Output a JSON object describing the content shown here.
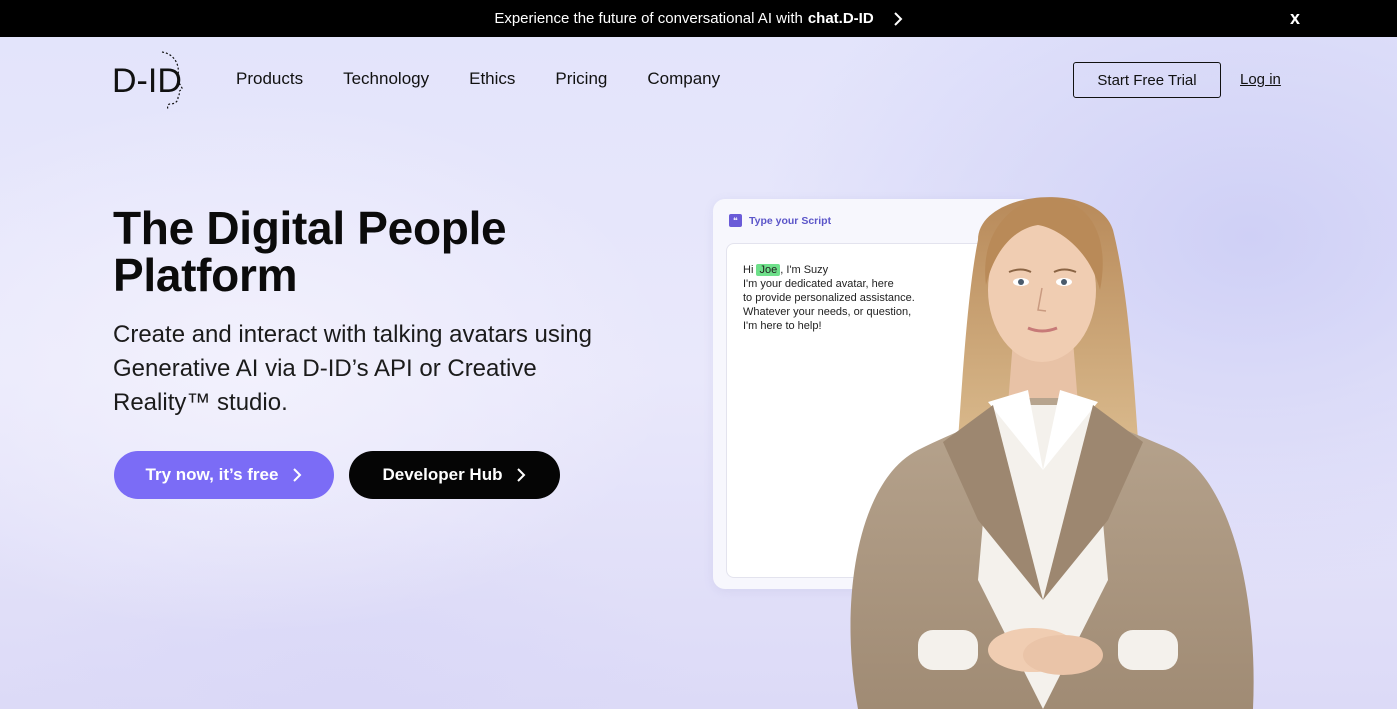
{
  "announcement": {
    "text": "Experience the future of conversational AI with",
    "brand": "chat.D-ID",
    "close_label": "x"
  },
  "header": {
    "logo_text": "D-ID",
    "nav": [
      "Products",
      "Technology",
      "Ethics",
      "Pricing",
      "Company"
    ],
    "trial_button": "Start Free Trial",
    "login_link": "Log in"
  },
  "hero": {
    "title_line1": "The Digital People",
    "title_line2": "Platform",
    "subtitle": "Create and interact with talking avatars using Generative AI via D-ID’s API or Creative Reality™ studio.",
    "primary_cta": "Try now, it’s free",
    "secondary_cta": "Developer Hub"
  },
  "script_card": {
    "title": "Type your Script",
    "greeting_prefix": "Hi",
    "highlight_name": "Joe",
    "greeting_suffix": ", I'm Suzy",
    "line2": "I'm your dedicated avatar, here",
    "line3": "to provide personalized assistance.",
    "line4": "Whatever your needs, or question,",
    "line5": "I'm here to help!"
  },
  "colors": {
    "accent": "#7b6cf6",
    "dark_button": "#050505",
    "highlight": "#6ee08a",
    "announcement_bg": "#000000"
  }
}
